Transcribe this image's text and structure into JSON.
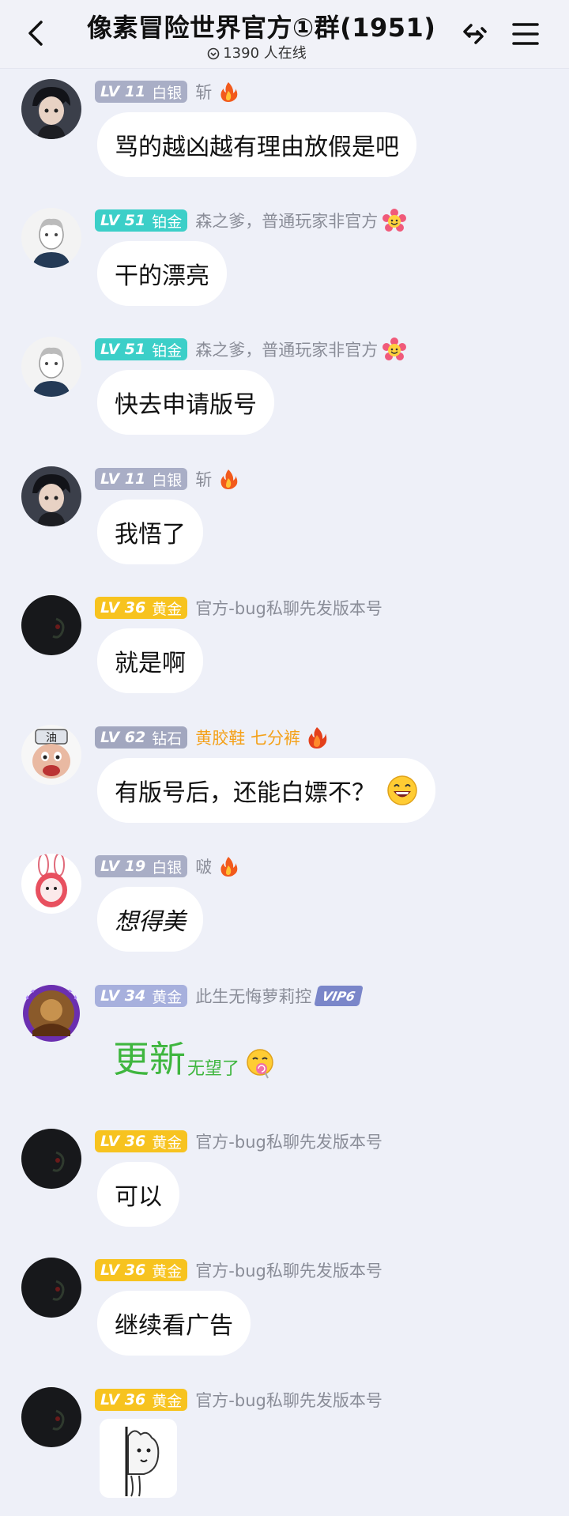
{
  "header": {
    "title": "像素冒险世界官方①群(1951)",
    "online": "1390 人在线"
  },
  "messages": [
    {
      "level": "LV 11",
      "rank": "白银",
      "badge": "silver",
      "nick": "斩",
      "nick_color": "gray",
      "deco": "fire",
      "type": "text",
      "text": "骂的越凶越有理由放假是吧",
      "avatar": "boy-dark"
    },
    {
      "level": "LV 51",
      "rank": "铂金",
      "badge": "plat",
      "nick": "森之爹，普通玩家非官方",
      "nick_color": "gray",
      "deco": "flower-face",
      "type": "text",
      "text": "干的漂亮",
      "avatar": "sketch-man"
    },
    {
      "level": "LV 51",
      "rank": "铂金",
      "badge": "plat",
      "nick": "森之爹，普通玩家非官方",
      "nick_color": "gray",
      "deco": "flower-face",
      "type": "text",
      "text": "快去申请版号",
      "avatar": "sketch-man"
    },
    {
      "level": "LV 11",
      "rank": "白银",
      "badge": "silver",
      "nick": "斩",
      "nick_color": "gray",
      "deco": "fire",
      "type": "text",
      "text": "我悟了",
      "avatar": "boy-dark"
    },
    {
      "level": "LV 36",
      "rank": "黄金",
      "badge": "gold",
      "nick": "官方-bug私聊先发版本号",
      "nick_color": "gray",
      "deco": "",
      "type": "text",
      "text": "就是啊",
      "avatar": "dark"
    },
    {
      "level": "LV 62",
      "rank": "钻石",
      "badge": "diamond",
      "nick": "黄胶鞋 七分裤",
      "nick_color": "orange",
      "deco": "fire-big",
      "type": "text",
      "text": "有版号后，还能白嫖不？",
      "emoji": "grin",
      "avatar": "oil-face"
    },
    {
      "level": "LV 19",
      "rank": "白银",
      "badge": "silver",
      "nick": "啵",
      "nick_color": "gray",
      "deco": "fire",
      "type": "text",
      "text": "想得美",
      "hand": true,
      "avatar": "bunny"
    },
    {
      "level": "LV 34",
      "rank": "黄金",
      "badge": "gold2",
      "nick": "此生无悔萝莉控",
      "nick_color": "gray",
      "deco": "vip",
      "vip_text": "VIP6",
      "type": "colorful",
      "big": "更新",
      "small": "无望了",
      "emoji": "lollipop",
      "avatar": "purple-frame"
    },
    {
      "level": "LV 36",
      "rank": "黄金",
      "badge": "gold",
      "nick": "官方-bug私聊先发版本号",
      "nick_color": "gray",
      "deco": "",
      "type": "text",
      "text": "可以",
      "avatar": "dark"
    },
    {
      "level": "LV 36",
      "rank": "黄金",
      "badge": "gold",
      "nick": "官方-bug私聊先发版本号",
      "nick_color": "gray",
      "deco": "",
      "type": "text",
      "text": "继续看广告",
      "avatar": "dark"
    },
    {
      "level": "LV 36",
      "rank": "黄金",
      "badge": "gold",
      "nick": "官方-bug私聊先发版本号",
      "nick_color": "gray",
      "deco": "",
      "type": "sticker",
      "avatar": "dark"
    }
  ]
}
